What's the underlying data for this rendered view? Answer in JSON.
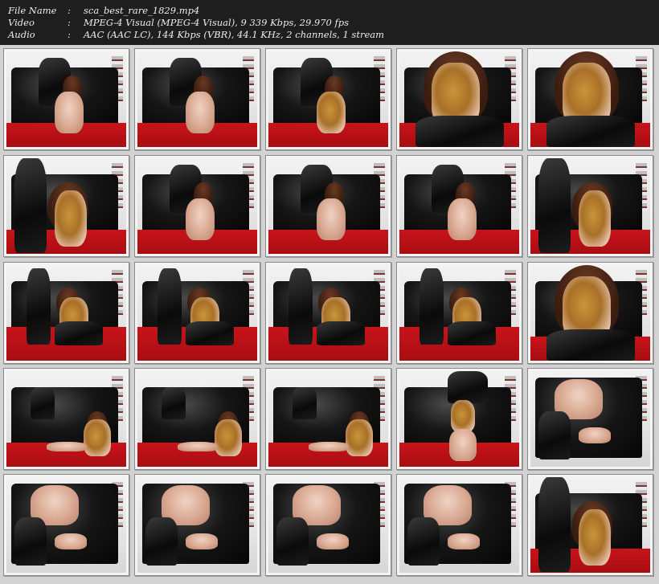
{
  "info": {
    "rows": [
      {
        "label": "File Name",
        "sep": ":",
        "value": "sca_best_rare_1829.mp4"
      },
      {
        "label": "Video",
        "sep": ":",
        "value": "MPEG-4 Visual (MPEG-4 Visual), 9 339 Kbps, 29.970 fps"
      },
      {
        "label": "Audio",
        "sep": ":",
        "value": "AAC (AAC LC), 144 Kbps (VBR), 44.1 KHz, 2 channels, 1 stream"
      }
    ]
  },
  "colors": {
    "header_bg": "#1e1e1e",
    "header_text": "#ececec",
    "sheet_bg": "#d2d2d2",
    "sofa": "#0a0a0a",
    "floor_red": "#c8141a"
  },
  "thumbnails": {
    "rows": 5,
    "cols": 5,
    "count": 25
  }
}
